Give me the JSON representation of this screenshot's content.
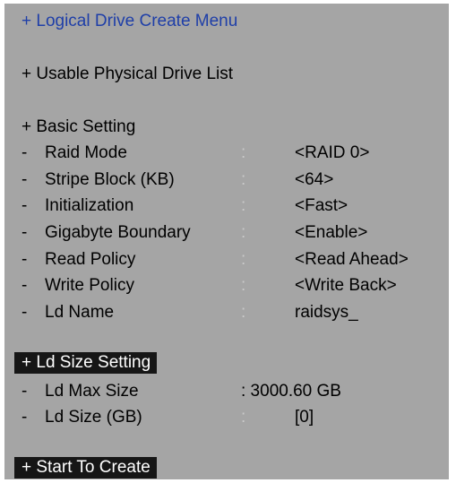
{
  "menu": {
    "title": "+ Logical Drive Create Menu",
    "usable_list": "+ Usable Physical Drive List",
    "basic_setting": "+ Basic Setting",
    "basic_rows": [
      {
        "label": "Raid Mode",
        "sep": ":",
        "value": "<RAID 0>"
      },
      {
        "label": "Stripe Block (KB)",
        "sep": ":",
        "value": "<64>"
      },
      {
        "label": "Initialization",
        "sep": ":",
        "value": "<Fast>"
      },
      {
        "label": "Gigabyte Boundary",
        "sep": ":",
        "value": "<Enable>"
      },
      {
        "label": "Read Policy",
        "sep": ":",
        "value": "<Read Ahead>"
      },
      {
        "label": "Write Policy",
        "sep": ":",
        "value": "<Write Back>"
      },
      {
        "label": "Ld Name",
        "sep": ":",
        "value": "raidsys_"
      }
    ],
    "size_setting": "+ Ld Size Setting",
    "ld_max_size": {
      "label": "Ld Max Size",
      "value": ": 3000.60 GB"
    },
    "ld_size": {
      "label": "Ld Size (GB)",
      "sep": ":",
      "value": "[0]"
    },
    "start_create": "+ Start To Create",
    "row_marker": "-"
  },
  "colors": {
    "panel_bg": "#a5a5a5",
    "title": "#1f3fa8",
    "highlight_bg": "#161616",
    "separator": "#c9c9c9"
  }
}
